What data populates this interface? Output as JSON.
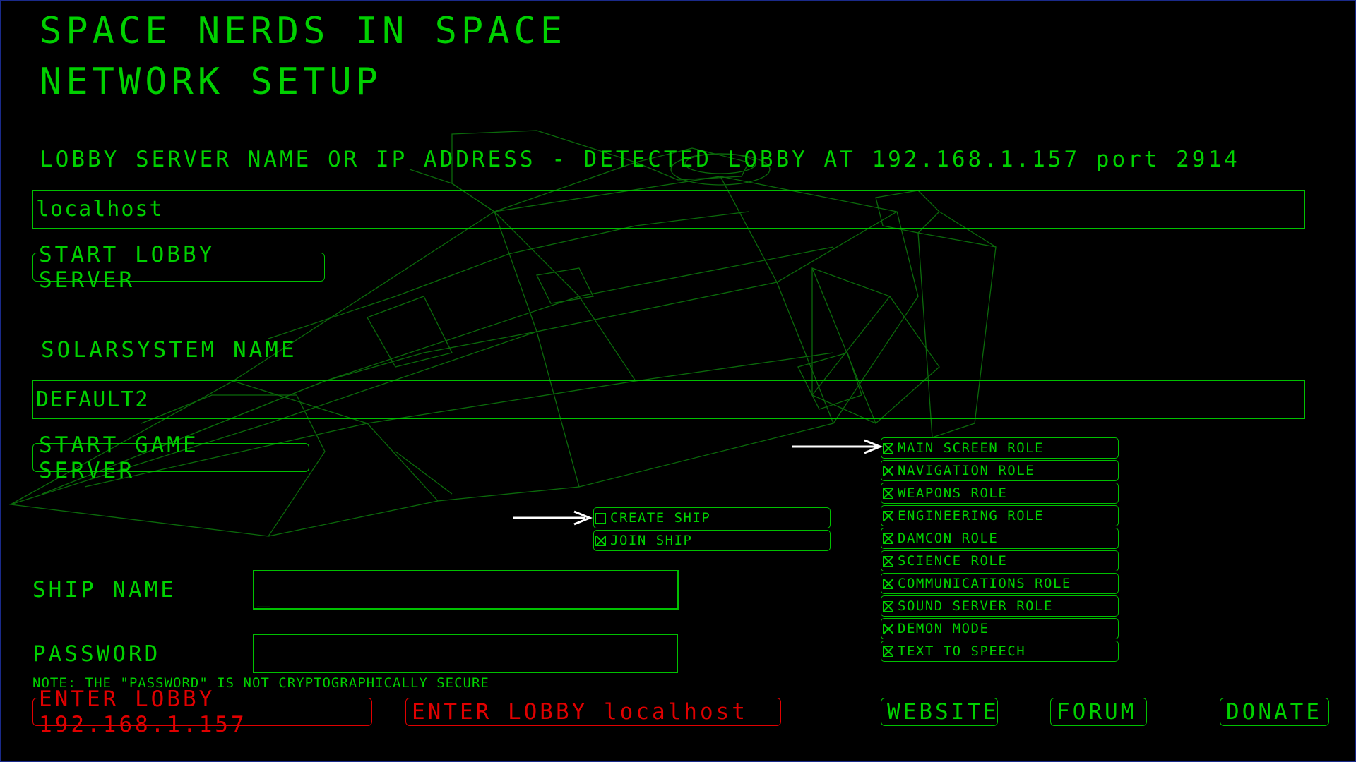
{
  "title": {
    "line1": "SPACE NERDS IN SPACE",
    "line2": "NETWORK SETUP"
  },
  "lobby": {
    "label": "LOBBY SERVER NAME OR IP ADDRESS - DETECTED LOBBY AT 192.168.1.157 port 2914",
    "value": "localhost",
    "start_button": "START LOBBY SERVER"
  },
  "solarsystem": {
    "label": "SOLARSYSTEM NAME",
    "value": "DEFAULT2",
    "start_button": "START GAME SERVER"
  },
  "ship_mode": [
    {
      "label": "CREATE SHIP",
      "checked": false
    },
    {
      "label": "JOIN SHIP",
      "checked": true
    }
  ],
  "roles": [
    {
      "label": "MAIN SCREEN ROLE",
      "checked": true
    },
    {
      "label": "NAVIGATION ROLE",
      "checked": true
    },
    {
      "label": "WEAPONS ROLE",
      "checked": true
    },
    {
      "label": "ENGINEERING ROLE",
      "checked": true
    },
    {
      "label": "DAMCON ROLE",
      "checked": true
    },
    {
      "label": "SCIENCE ROLE",
      "checked": true
    },
    {
      "label": "COMMUNICATIONS ROLE",
      "checked": true
    },
    {
      "label": "SOUND SERVER ROLE",
      "checked": true
    },
    {
      "label": "DEMON MODE",
      "checked": true
    },
    {
      "label": "TEXT TO SPEECH",
      "checked": true
    }
  ],
  "ship_name": {
    "label": "SHIP NAME",
    "value": "_"
  },
  "password": {
    "label": "PASSWORD",
    "value": "",
    "note": "NOTE: THE \"PASSWORD\" IS NOT CRYPTOGRAPHICALLY SECURE"
  },
  "buttons": {
    "enter_lobby_ip": "ENTER LOBBY 192.168.1.157",
    "enter_lobby_host": "ENTER LOBBY localhost",
    "website": "WEBSITE",
    "forum": "FORUM",
    "donate": "DONATE"
  },
  "colors": {
    "ui_green": "#00d000",
    "warning_red": "#e00000",
    "background": "#000000",
    "wireframe": "#0a5a0a",
    "pointer_arrows": "#ffffff"
  }
}
